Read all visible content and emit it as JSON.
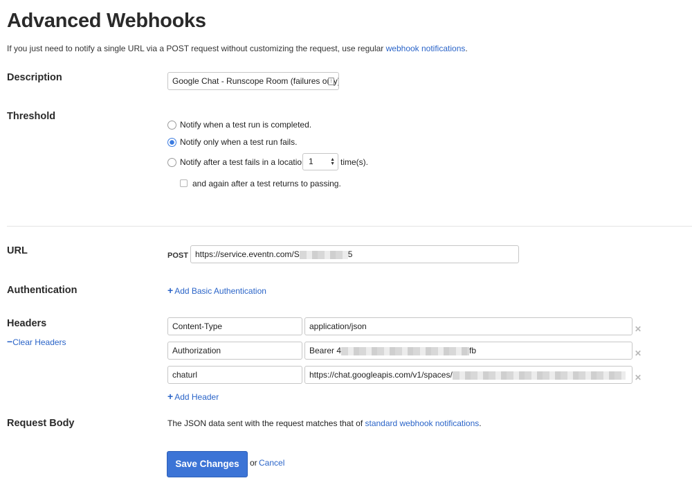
{
  "header": {
    "title": "Advanced Webhooks",
    "intro_prefix": "If you just need to notify a single URL via a POST request without customizing the request, use regular ",
    "intro_link": "webhook notifications",
    "intro_suffix": "."
  },
  "description": {
    "label": "Description",
    "value": "Google Chat - Runscope Room (failures only)"
  },
  "threshold": {
    "label": "Threshold",
    "options": [
      {
        "text": "Notify when a test run is completed.",
        "selected": false
      },
      {
        "text": "Notify only when a test run fails.",
        "selected": true
      },
      {
        "text": "Notify after a test fails in a location",
        "selected": false
      }
    ],
    "count_value": "1",
    "count_suffix": "time(s).",
    "again_label": "and again after a test returns to passing.",
    "again_checked": false
  },
  "url": {
    "label": "URL",
    "method": "POST",
    "value_prefix": "https://service.eventn.com/S",
    "value_suffix": "5"
  },
  "authentication": {
    "label": "Authentication",
    "add_link": "Add Basic Authentication"
  },
  "headers": {
    "label": "Headers",
    "clear_link": "Clear Headers",
    "add_link": "Add Header",
    "rows": [
      {
        "name": "Content-Type",
        "value_prefix": "application/json",
        "value_suffix": ""
      },
      {
        "name": "Authorization",
        "value_prefix": "Bearer 4",
        "value_suffix": "fb"
      },
      {
        "name": "chaturl",
        "value_prefix": "https://chat.googleapis.com/v1/spaces/",
        "value_suffix": ""
      }
    ]
  },
  "request_body": {
    "label": "Request Body",
    "text_prefix": "The JSON data sent with the request matches that of ",
    "link": "standard webhook notifications",
    "text_suffix": "."
  },
  "actions": {
    "save_label": "Save Changes",
    "or_text": "or",
    "cancel_label": "Cancel"
  },
  "colors": {
    "link": "#2a64c8",
    "primary_button": "#3c74d6",
    "radio_selected": "#3b7be0"
  }
}
